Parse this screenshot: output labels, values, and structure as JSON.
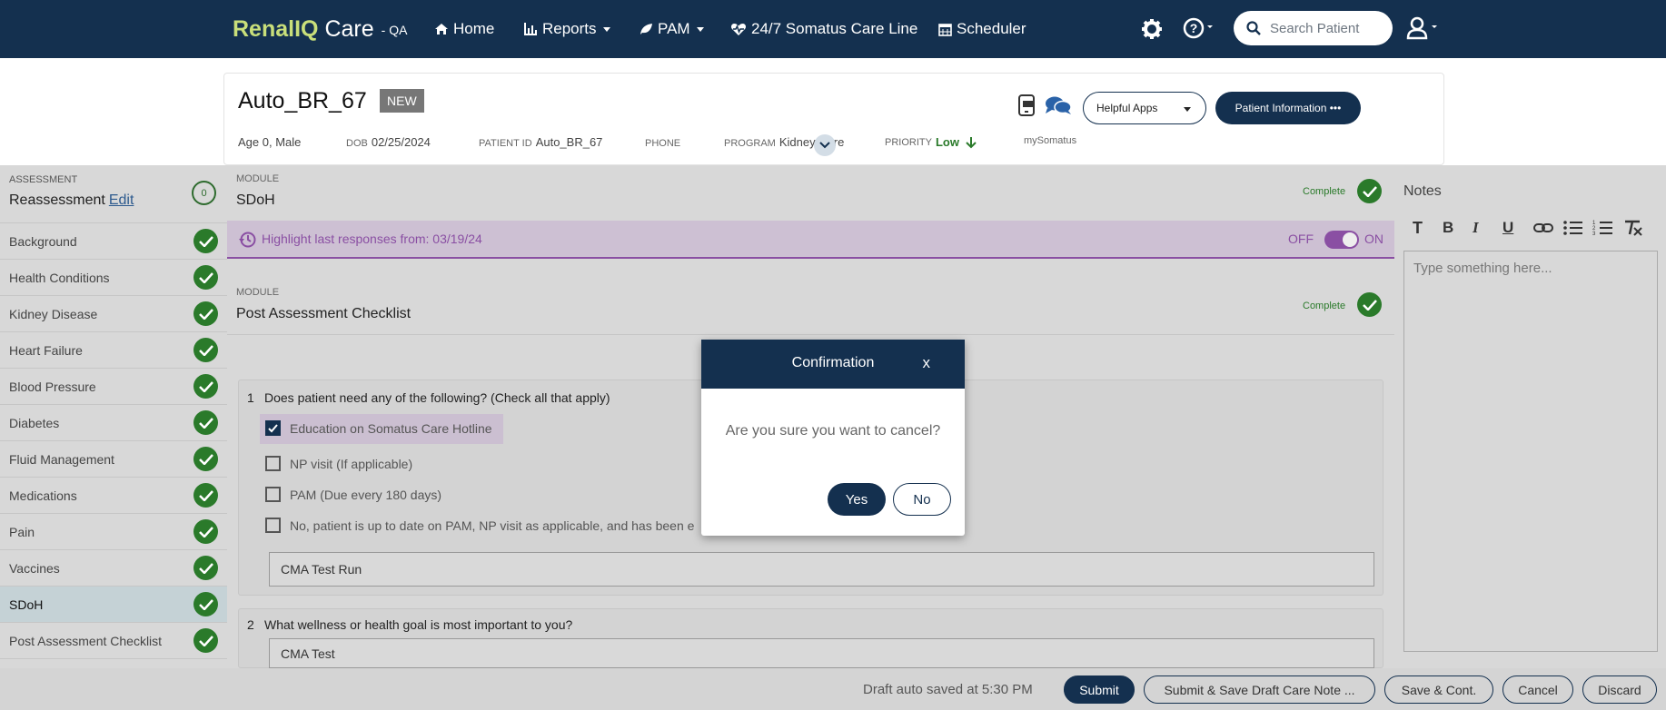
{
  "nav": {
    "brand_part1": "Renal",
    "brand_part2": "IQ",
    "brand_part3": "Care",
    "env": "- QA",
    "home": "Home",
    "reports": "Reports",
    "pam": "PAM",
    "careline": "24/7 Somatus Care Line",
    "scheduler": "Scheduler",
    "search_placeholder": "Search Patient"
  },
  "patient": {
    "name": "Auto_BR_67",
    "badge": "NEW",
    "age": "Age 0, Male",
    "dob_label": "DOB",
    "dob": "02/25/2024",
    "pid_label": "PATIENT ID",
    "pid": "Auto_BR_67",
    "phone_label": "PHONE",
    "program_label": "PROGRAM",
    "program": "Kidney Care",
    "priority_label": "PRIORITY",
    "priority": "Low",
    "mysomatus": "mySomatus",
    "helpful_apps": "Helpful Apps",
    "patient_info": "Patient Information •••"
  },
  "sidebar": {
    "assessment_label": "ASSESSMENT",
    "assessment_title": "Reassessment",
    "edit": "Edit",
    "count": "0",
    "items": [
      {
        "label": "Background"
      },
      {
        "label": "Health Conditions"
      },
      {
        "label": "Kidney Disease"
      },
      {
        "label": "Heart Failure"
      },
      {
        "label": "Blood Pressure"
      },
      {
        "label": "Diabetes"
      },
      {
        "label": "Fluid Management"
      },
      {
        "label": "Medications"
      },
      {
        "label": "Pain"
      },
      {
        "label": "Vaccines"
      },
      {
        "label": "SDoH"
      },
      {
        "label": "Post Assessment Checklist"
      }
    ]
  },
  "main": {
    "module_label": "MODULE",
    "module1_title": "SDoH",
    "complete": "Complete",
    "highlight": "Highlight last responses from: 03/19/24",
    "toggle_off": "OFF",
    "toggle_on": "ON",
    "module2_title": "Post Assessment Checklist",
    "q1_num": "1",
    "q1": "Does patient need any of the following? (Check all that apply)",
    "q1_options": [
      "Education on Somatus Care Hotline",
      "NP visit (If applicable)",
      "PAM (Due every 180 days)",
      "No, patient is up to date on PAM, NP visit as applicable, and has been e"
    ],
    "q1_answer": "CMA Test Run",
    "q2_num": "2",
    "q2": "What wellness or health goal is most important to you?",
    "q2_answer": "CMA Test"
  },
  "notes": {
    "title": "Notes",
    "placeholder": "Type something here..."
  },
  "footer": {
    "draft": "Draft auto saved at 5:30 PM",
    "submit": "Submit",
    "submit_draft": "Submit & Save Draft Care Note ...",
    "save_cont": "Save & Cont.",
    "cancel": "Cancel",
    "discard": "Discard"
  },
  "modal": {
    "title": "Confirmation",
    "close": "x",
    "message": "Are you sure you want to cancel?",
    "yes": "Yes",
    "no": "No"
  }
}
